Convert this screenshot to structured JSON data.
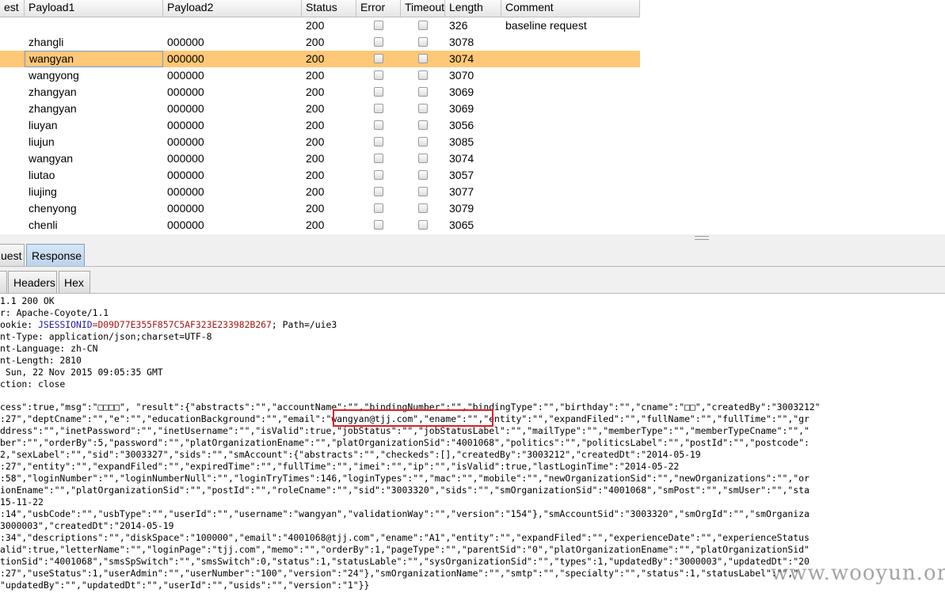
{
  "table": {
    "columns": [
      "est",
      "Payload1",
      "Payload2",
      "Status",
      "Error",
      "Timeout",
      "Length",
      "Comment"
    ],
    "rows": [
      {
        "p1": "",
        "p2": "",
        "status": "200",
        "length": "326",
        "comment": "baseline request"
      },
      {
        "p1": "zhangli",
        "p2": "000000",
        "status": "200",
        "length": "3078",
        "comment": ""
      },
      {
        "p1": "wangyan",
        "p2": "000000",
        "status": "200",
        "length": "3074",
        "comment": ""
      },
      {
        "p1": "wangyong",
        "p2": "000000",
        "status": "200",
        "length": "3070",
        "comment": ""
      },
      {
        "p1": "zhangyan",
        "p2": "000000",
        "status": "200",
        "length": "3069",
        "comment": ""
      },
      {
        "p1": "zhangyan",
        "p2": "000000",
        "status": "200",
        "length": "3069",
        "comment": ""
      },
      {
        "p1": "liuyan",
        "p2": "000000",
        "status": "200",
        "length": "3056",
        "comment": ""
      },
      {
        "p1": "liujun",
        "p2": "000000",
        "status": "200",
        "length": "3085",
        "comment": ""
      },
      {
        "p1": "wangyan",
        "p2": "000000",
        "status": "200",
        "length": "3074",
        "comment": ""
      },
      {
        "p1": "liutao",
        "p2": "000000",
        "status": "200",
        "length": "3057",
        "comment": ""
      },
      {
        "p1": "liujing",
        "p2": "000000",
        "status": "200",
        "length": "3077",
        "comment": ""
      },
      {
        "p1": "chenyong",
        "p2": "000000",
        "status": "200",
        "length": "3079",
        "comment": ""
      },
      {
        "p1": "chenli",
        "p2": "000000",
        "status": "200",
        "length": "3065",
        "comment": ""
      }
    ],
    "selected_row_color": "#ffc878"
  },
  "tabs": {
    "request_label": "uest",
    "response_label": "Response",
    "headers_label": "Headers",
    "hex_label": "Hex"
  },
  "response": {
    "headers": [
      "1.1 200 OK",
      "r: Apache-Coyote/1.1",
      "ookie: ",
      "nt-Type: application/json;charset=UTF-8",
      "nt-Language: zh-CN",
      "nt-Length: 2810",
      " Sun, 22 Nov 2015 09:05:35 GMT",
      "ction: close"
    ],
    "cookie_name": "JSESSIONID",
    "cookie_value": "=D09D77E355F857C5AF323E233982B267",
    "cookie_rest": "; Path=/uie3",
    "body": [
      "cess\":true,\"msg\":\"□□□□\", \"result\":{\"abstracts\":\"\",\"accountName\":\"\",\"bindingNumber\":\"\",\"bindingType\":\"\",\"birthday\":\"\",\"cname\":\"□□\",\"createdBy\":\"3003212\"",
      ":27\",\"deptCname\":\"\",\"e\":\"\",\"educationBackground\":\"\",\"email\":\"wangyan@tjj.com\",\"ename\":\"\",\"entity\":\"\",\"expandFiled\":\"\",\"fullName\":\"\",\"fullTime\":\"\",\"gr",
      "ddress\":\"\",\"inetPassword\":\"\",\"inetUsername\":\"\",\"isValid\":true,\"jobStatus\":\"\",\"jobStatusLabel\":\"\",\"mailType\":\"\",\"memberType\":\"\",\"memberTypeCname\":\"\",\"",
      "ber\":\"\",\"orderBy\":5,\"password\":\"\",\"platOrganizationEname\":\"\",\"platOrganizationSid\":\"4001068\",\"politics\":\"\",\"politicsLabel\":\"\",\"postId\":\"\",\"postcode\":",
      "2,\"sexLabel\":\"\",\"sid\":\"3003327\",\"sids\":\"\",\"smAccount\":{\"abstracts\":\"\",\"checkeds\":[],\"createdBy\":\"3003212\",\"createdDt\":\"2014-05-19",
      ":27\",\"entity\":\"\",\"expandFiled\":\"\",\"expiredTime\":\"\",\"fullTime\":\"\",\"imei\":\"\",\"ip\":\"\",\"isValid\":true,\"lastLoginTime\":\"2014-05-22",
      ":58\",\"loginNumber\":\"\",\"loginNumberNull\":\"\",\"loginTryTimes\":146,\"loginTypes\":\"\",\"mac\":\"\",\"mobile\":\"\",\"newOrganizationSid\":\"\",\"newOrganizations\":\"\",\"or",
      "ionEname\":\"\",\"platOrganizationSid\":\"\",\"postId\":\"\",\"roleCname\":\"\",\"sid\":\"3003320\",\"sids\":\"\",\"smOrganizationSid\":\"4001068\",\"smPost\":\"\",\"smUser\":\"\",\"sta",
      "15-11-22",
      ":14\",\"usbCode\":\"\",\"usbType\":\"\",\"userId\":\"\",\"username\":\"wangyan\",\"validationWay\":\"\",\"version\":\"154\"},\"smAccountSid\":\"3003320\",\"smOrgId\":\"\",\"smOrganiza",
      "3000003\",\"createdDt\":\"2014-05-19",
      ":34\",\"descriptions\":\"\",\"diskSpace\":\"100000\",\"email\":\"4001068@tjj.com\",\"ename\":\"A1\",\"entity\":\"\",\"expandFiled\":\"\",\"experienceDate\":\"\",\"experienceStatus",
      "alid\":true,\"letterName\":\"\",\"loginPage\":\"tjj.com\",\"memo\":\"\",\"orderBy\":1,\"pageType\":\"\",\"parentSid\":\"0\",\"platOrganizationEname\":\"\",\"platOrganizationSid\"",
      "tionSid\":\"4001068\",\"smsSpSwitch\":\"\",\"smsSwitch\":0,\"status\":1,\"statusLable\":\"\",\"sysOrganizationSid\":\"\",\"types\":1,\"updatedBy\":\"3000003\",\"updatedDt\":\"20",
      ":27\",\"useStatus\":1,\"userAdmin\":\"\",\"userNumber\":\"100\",\"version\":\"24\"},\"smOrganizationName\":\"\",\"smtp\":\"\",\"specialty\":\"\",\"status\":1,\"statusLabel\":\"\",\"",
      "\"updatedBy\":\"\",\"updatedDt\":\"\",\"userId\":\"\",\"usids\":\"\",\"version\":\"1\"}}"
    ]
  },
  "watermark": "www.wooyun.org",
  "colors": {
    "accent_tab": "#bcd3ea",
    "highlight_box": "#e02020",
    "cookie_key": "#1a1aa6",
    "cookie_value": "#a31515"
  }
}
